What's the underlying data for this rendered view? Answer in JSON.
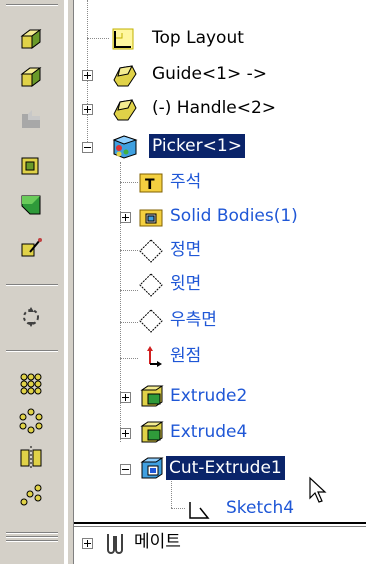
{
  "toolbar": {
    "buttons": [
      {
        "name": "extruded-boss-icon",
        "color": "#e0d248"
      },
      {
        "name": "revolved-boss-icon",
        "color": "#e0d248"
      },
      {
        "name": "fillet-disabled-icon",
        "color": "#a8a8a8"
      },
      {
        "name": "shell-icon",
        "color": "#e0d248"
      },
      {
        "name": "draft-icon",
        "color": "#2f9a3a"
      },
      {
        "name": "wizard-icon",
        "color": "#c0a000"
      },
      {
        "name": "move-component-icon",
        "color": "#404040"
      },
      {
        "name": "linear-pattern-icon",
        "color": "#e0d248"
      },
      {
        "name": "circular-pattern-icon",
        "color": "#e0d248"
      },
      {
        "name": "mirror-icon",
        "color": "#e0d248"
      },
      {
        "name": "sketch-pattern-icon",
        "color": "#e0d248"
      }
    ]
  },
  "tree": {
    "items": [
      {
        "label": "Top Layout",
        "color": "black"
      },
      {
        "label": "Guide<1> ->",
        "color": "black"
      },
      {
        "label": "(-) Handle<2>",
        "color": "black"
      },
      {
        "label": "Picker<1>",
        "color": "selected"
      },
      {
        "label": "주석",
        "color": "blue"
      },
      {
        "label": "Solid Bodies(1)",
        "color": "blue"
      },
      {
        "label": "정면",
        "color": "blue"
      },
      {
        "label": "윗면",
        "color": "blue"
      },
      {
        "label": "우측면",
        "color": "blue"
      },
      {
        "label": "원점",
        "color": "blue"
      },
      {
        "label": "Extrude2",
        "color": "blue"
      },
      {
        "label": "Extrude4",
        "color": "blue"
      },
      {
        "label": "Cut-Extrude1",
        "color": "selected"
      },
      {
        "label": "Sketch4",
        "color": "blue"
      },
      {
        "label": "메이트",
        "color": "black"
      }
    ]
  }
}
